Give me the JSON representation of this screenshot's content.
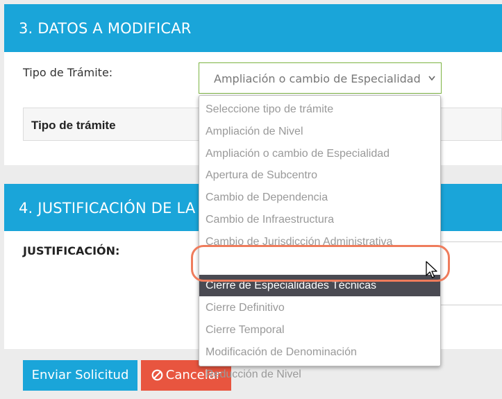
{
  "section3": {
    "title": "3. DATOS A MODIFICAR",
    "tipo_label": "Tipo de Trámite:",
    "select_value": "Ampliación o cambio de Especialidad",
    "table_header": "Tipo de trámite"
  },
  "section4": {
    "title": "4. JUSTIFICACIÓN DE LA",
    "justificacion_label": "JUSTIFICACIÓN:"
  },
  "buttons": {
    "send_label": "Enviar Solicitud",
    "cancel_label": "Cancelar"
  },
  "dropdown": {
    "selected_index": 8,
    "options": [
      "Seleccione tipo de trámite",
      "Ampliación de Nivel",
      "Ampliación o cambio de Especialidad",
      "Apertura de Subcentro",
      "Cambio de Dependencia",
      "Cambio de Infraestructura",
      "Cambio de Jurisdicción Administrativa",
      "",
      "Cierre de Especialidades Técnicas",
      "Cierre Definitivo",
      "Cierre Temporal",
      "Modificación de Denominación",
      "Reducción de Nivel"
    ]
  },
  "colors": {
    "accent": "#1aa5d9",
    "danger": "#e8553f",
    "highlight_ring": "#ef7c5c",
    "selected_option_bg": "#4a4a52"
  },
  "icons": {
    "select_chevron": "chevron-down-icon",
    "cancel_icon": "ban-icon",
    "cursor": "mouse-pointer-icon"
  }
}
